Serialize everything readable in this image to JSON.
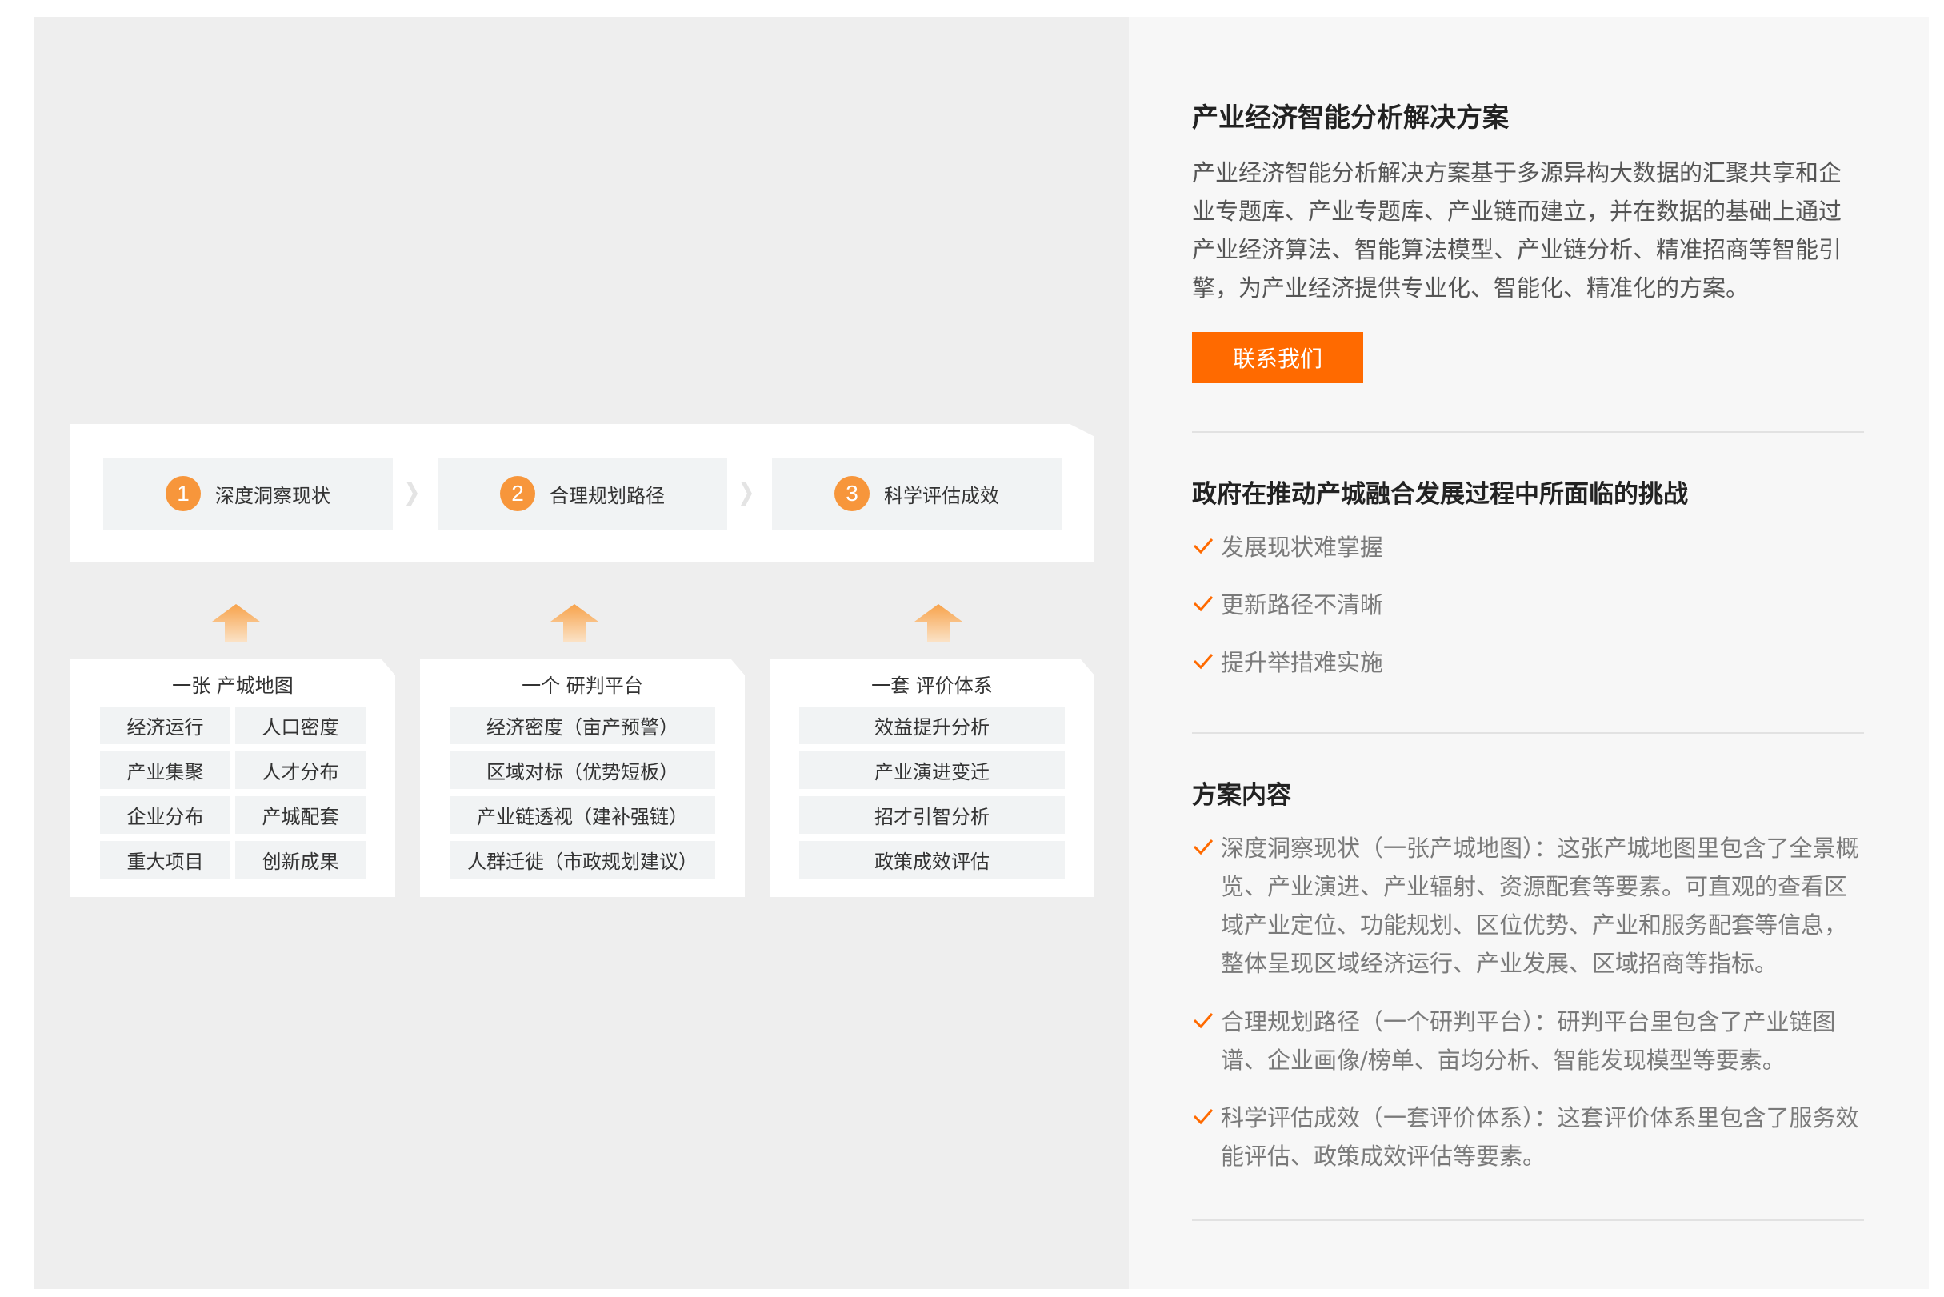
{
  "colors": {
    "accent": "#ff6a00",
    "step_circle": "#f7963b",
    "arrow": "#f7a24a",
    "cell_bg": "#f1f3f4"
  },
  "diagram": {
    "steps": [
      {
        "num": "1",
        "label": "深度洞察现状"
      },
      {
        "num": "2",
        "label": "合理规划路径"
      },
      {
        "num": "3",
        "label": "科学评估成效"
      }
    ],
    "cards": [
      {
        "title": "一张 产城地图",
        "items": [
          "经济运行",
          "人口密度",
          "产业集聚",
          "人才分布",
          "企业分布",
          "产城配套",
          "重大项目",
          "创新成果"
        ]
      },
      {
        "title": "一个 研判平台",
        "items": [
          "经济密度（亩产预警）",
          "区域对标（优势短板）",
          "产业链透视（建补强链）",
          "人群迁徙（市政规划建议）"
        ]
      },
      {
        "title": "一套 评价体系",
        "items": [
          "效益提升分析",
          "产业演进变迁",
          "招才引智分析",
          "政策成效评估"
        ]
      }
    ]
  },
  "solution": {
    "title": "产业经济智能分析解决方案",
    "description": "产业经济智能分析解决方案基于多源异构大数据的汇聚共享和企业专题库、产业专题库、产业链而建立，并在数据的基础上通过产业经济算法、智能算法模型、产业链分析、精准招商等智能引擎，为产业经济提供专业化、智能化、精准化的方案。",
    "contact_button": "联系我们"
  },
  "challenges": {
    "title": "政府在推动产城融合发展过程中所面临的挑战",
    "items": [
      "发展现状难掌握",
      "更新路径不清晰",
      "提升举措难实施"
    ]
  },
  "content": {
    "title": "方案内容",
    "items": [
      "深度洞察现状（一张产城地图）：这张产城地图里包含了全景概览、产业演进、产业辐射、资源配套等要素。可直观的查看区域产业定位、功能规划、区位优势、产业和服务配套等信息，整体呈现区域经济运行、产业发展、区域招商等指标。",
      "合理规划路径（一个研判平台）：研判平台里包含了产业链图谱、企业画像/榜单、亩均分析、智能发现模型等要素。",
      "科学评估成效（一套评价体系）：这套评价体系里包含了服务效能评估、政策成效评估等要素。"
    ]
  }
}
